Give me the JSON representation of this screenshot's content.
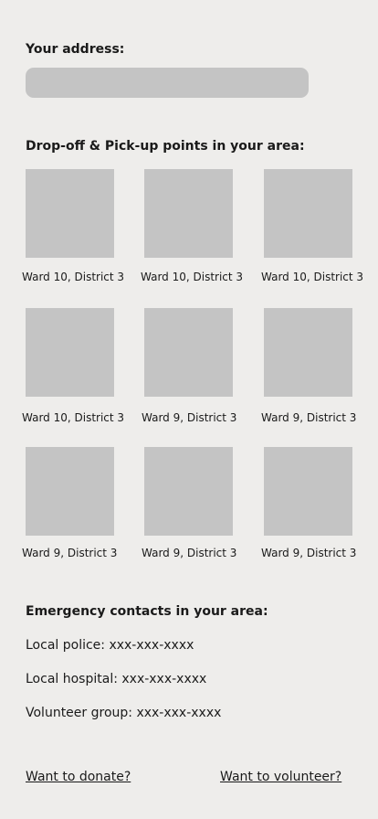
{
  "address": {
    "label": "Your address:",
    "value": ""
  },
  "points": {
    "title": "Drop-off & Pick-up points in your area:",
    "items": [
      {
        "label": "Ward 10, District 3"
      },
      {
        "label": "Ward 10, District 3"
      },
      {
        "label": "Ward 10, District 3"
      },
      {
        "label": "Ward 10, District 3"
      },
      {
        "label": "Ward 9, District 3"
      },
      {
        "label": "Ward 9, District 3"
      },
      {
        "label": "Ward 9, District 3"
      },
      {
        "label": "Ward 9, District 3"
      },
      {
        "label": "Ward 9, District 3"
      }
    ]
  },
  "contacts": {
    "title": "Emergency contacts in your area:",
    "police": "Local police: xxx-xxx-xxxx",
    "hospital": "Local hospital: xxx-xxx-xxxx",
    "volunteer": "Volunteer group: xxx-xxx-xxxx"
  },
  "links": {
    "donate": "Want to donate?",
    "volunteer": "Want to volunteer?"
  },
  "colors": {
    "background": "#eeedeb",
    "placeholder": "#c4c4c4"
  }
}
